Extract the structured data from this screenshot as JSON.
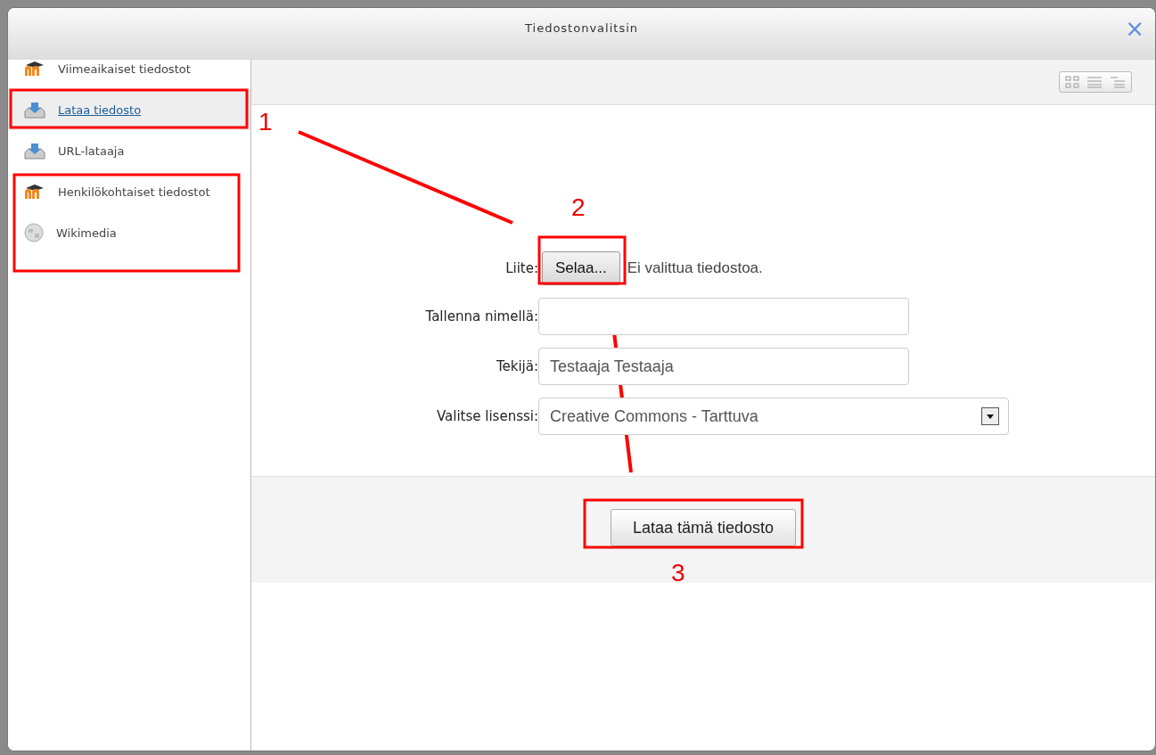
{
  "window": {
    "title": "Tiedostonvalitsin",
    "close": "×"
  },
  "sidebar": {
    "items": [
      {
        "label": "Viimeaikaiset tiedostot",
        "kind": "moodle",
        "selected": false
      },
      {
        "label": "Lataa tiedosto",
        "kind": "upload",
        "selected": true
      },
      {
        "label": "URL-lataaja",
        "kind": "upload",
        "selected": false
      },
      {
        "label": "Henkilökohtaiset tiedostot",
        "kind": "moodle",
        "selected": false
      },
      {
        "label": "Wikimedia",
        "kind": "wiki",
        "selected": false
      }
    ]
  },
  "view_buttons": [
    {
      "kind": "icons"
    },
    {
      "kind": "list"
    },
    {
      "kind": "tree"
    }
  ],
  "form": {
    "fields": [
      {
        "label": "Liite:",
        "kind": "file",
        "button": "Selaa...",
        "value": "Ei valittua tiedostoa."
      },
      {
        "label": "Tallenna nimellä:",
        "kind": "text"
      },
      {
        "label": "Tekijä:",
        "kind": "text",
        "value": "Testaaja Testaaja"
      },
      {
        "label": "Valitse lisenssi:",
        "kind": "select",
        "value": "Creative Commons - Tarttuva"
      }
    ],
    "submit": "Lataa tämä tiedosto"
  },
  "annotations": {
    "numbers": [
      "1",
      "2",
      "3"
    ]
  }
}
